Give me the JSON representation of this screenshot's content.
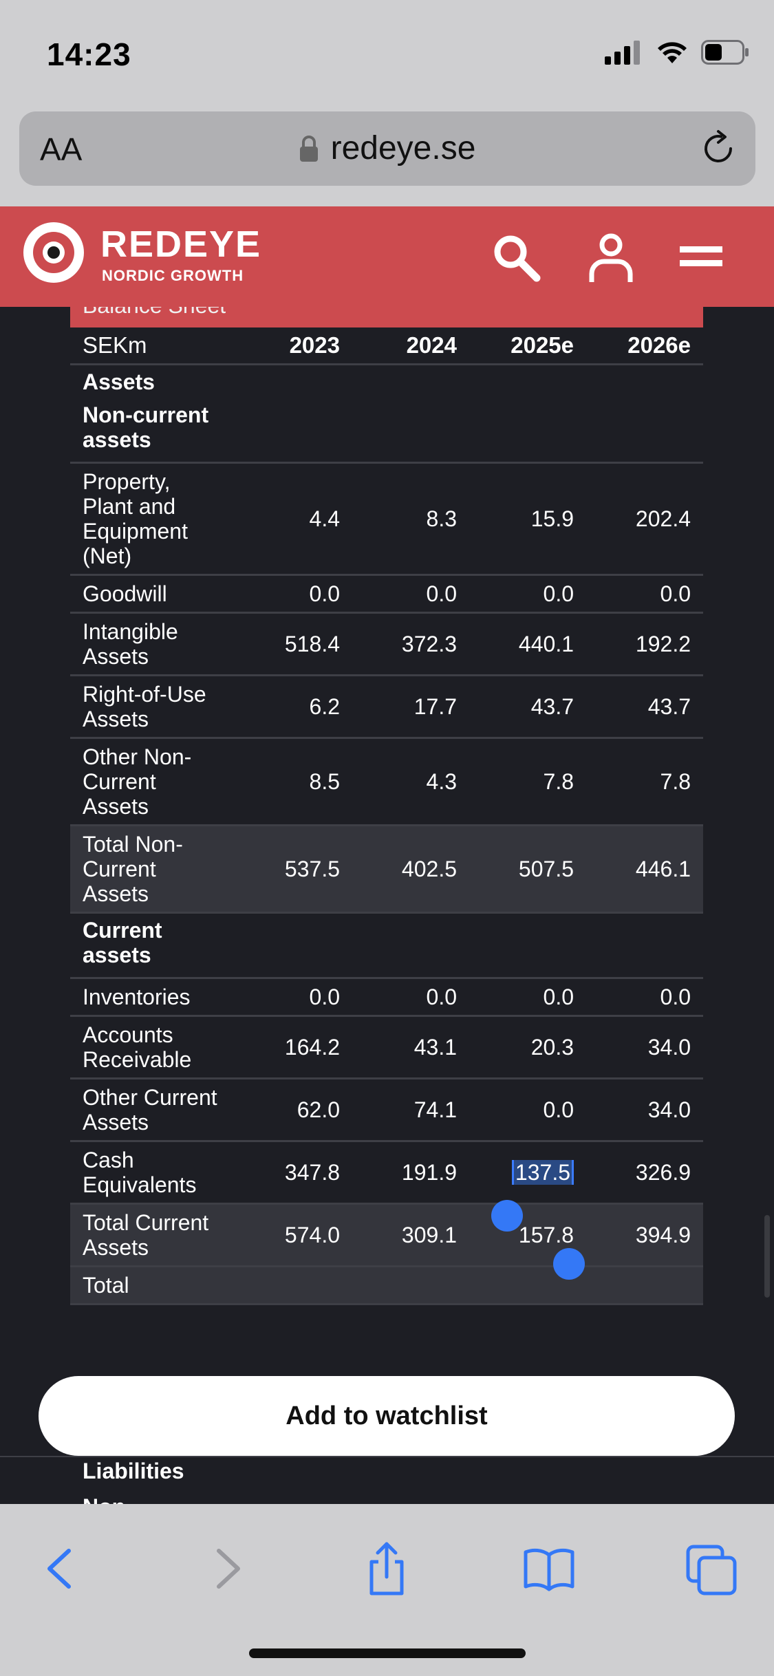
{
  "status_bar": {
    "time": "14:23"
  },
  "address_bar": {
    "text_size_label": "AA",
    "url": "redeye.se"
  },
  "site": {
    "logo_title": "REDEYE",
    "logo_subtitle": "NORDIC GROWTH"
  },
  "table": {
    "section_title": "Balance Sheet",
    "columns": [
      "SEKm",
      "2023",
      "2024",
      "2025e",
      "2026e"
    ],
    "rows": [
      {
        "type": "section",
        "label": "Assets"
      },
      {
        "type": "section",
        "label": "Non-current assets"
      },
      {
        "type": "data",
        "label": "Property, Plant and Equipment (Net)",
        "values": [
          "4.4",
          "8.3",
          "15.9",
          "202.4"
        ]
      },
      {
        "type": "data",
        "label": "Goodwill",
        "values": [
          "0.0",
          "0.0",
          "0.0",
          "0.0"
        ]
      },
      {
        "type": "data",
        "label": "Intangible Assets",
        "values": [
          "518.4",
          "372.3",
          "440.1",
          "192.2"
        ]
      },
      {
        "type": "data",
        "label": "Right-of-Use Assets",
        "values": [
          "6.2",
          "17.7",
          "43.7",
          "43.7"
        ]
      },
      {
        "type": "data",
        "label": "Other Non-Current Assets",
        "values": [
          "8.5",
          "4.3",
          "7.8",
          "7.8"
        ]
      },
      {
        "type": "total",
        "label": "Total Non-Current Assets",
        "values": [
          "537.5",
          "402.5",
          "507.5",
          "446.1"
        ]
      },
      {
        "type": "section",
        "label": "Current assets"
      },
      {
        "type": "data",
        "label": "Inventories",
        "values": [
          "0.0",
          "0.0",
          "0.0",
          "0.0"
        ]
      },
      {
        "type": "data",
        "label": "Accounts Receivable",
        "values": [
          "164.2",
          "43.1",
          "20.3",
          "34.0"
        ]
      },
      {
        "type": "data",
        "label": "Other Current Assets",
        "values": [
          "62.0",
          "74.1",
          "0.0",
          "34.0"
        ]
      },
      {
        "type": "data",
        "label": "Cash Equivalents",
        "values": [
          "347.8",
          "191.9",
          "137.5",
          "326.9"
        ]
      },
      {
        "type": "total",
        "label": "Total Current Assets",
        "values": [
          "574.0",
          "309.1",
          "157.8",
          "394.9"
        ]
      },
      {
        "type": "total",
        "label": "Total",
        "values": [
          "",
          "",
          "",
          ""
        ]
      }
    ],
    "selected_cell": "137.5",
    "liabilities_label": "Liabilities",
    "liabilities_next": "Non"
  },
  "watchlist_button": "Add to watchlist",
  "colors": {
    "brand_red": "#cc4b4f",
    "selection_blue": "#3478f6",
    "ios_blue": "#3478f6"
  }
}
